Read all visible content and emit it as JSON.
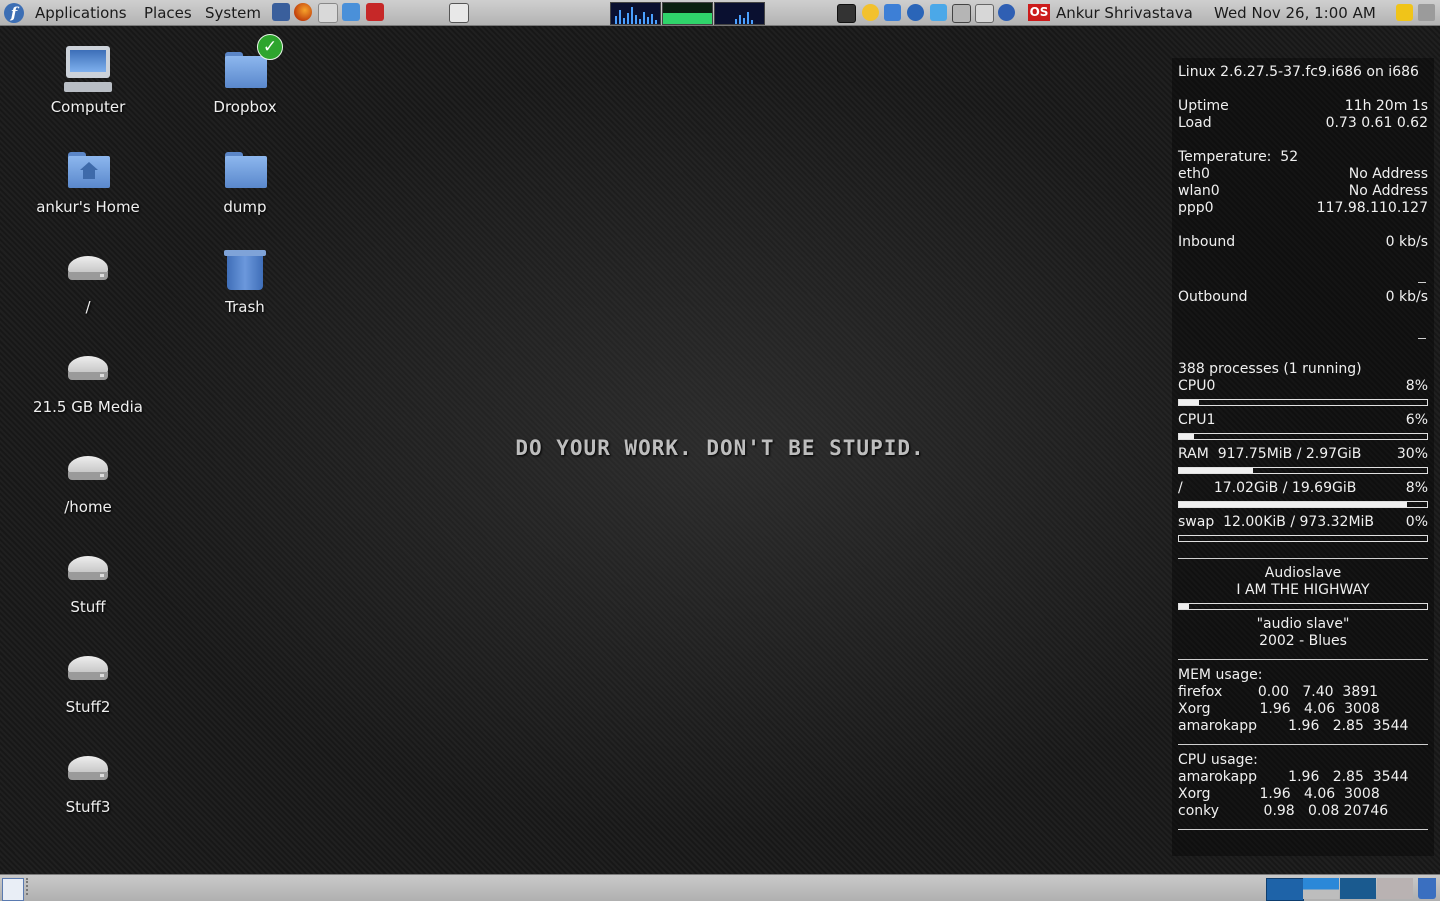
{
  "top_panel": {
    "menus": [
      "Applications",
      "Places",
      "System"
    ],
    "launchers": [
      "save-icon",
      "firefox-icon",
      "mail-icon",
      "document-icon",
      "phone-icon",
      "screenshot-icon"
    ],
    "user": "Ankur Shrivastava",
    "clock": "Wed Nov 26,  1:00 AM",
    "tray_os_label": "OS"
  },
  "desktop": {
    "icons": [
      {
        "label": "Computer",
        "icon": "computer-icon"
      },
      {
        "label": "ankur's Home",
        "icon": "home-folder-icon"
      },
      {
        "label": "/",
        "icon": "drive-icon"
      },
      {
        "label": "21.5 GB Media",
        "icon": "drive-icon"
      },
      {
        "label": "/home",
        "icon": "drive-icon"
      },
      {
        "label": "Stuff",
        "icon": "drive-icon"
      },
      {
        "label": "Stuff2",
        "icon": "drive-icon"
      },
      {
        "label": "Stuff3",
        "icon": "drive-icon"
      },
      {
        "label": "Dropbox",
        "icon": "dropbox-folder-icon"
      },
      {
        "label": "dump",
        "icon": "folder-icon"
      },
      {
        "label": "Trash",
        "icon": "trash-icon"
      }
    ],
    "slogan": "DO YOUR WORK. DON'T BE STUPID."
  },
  "conky": {
    "kernel": "Linux 2.6.27.5-37.fc9.i686 on i686",
    "uptime_label": "Uptime",
    "uptime": "11h 20m 1s",
    "load_label": "Load",
    "load": "0.73 0.61 0.62",
    "temperature": "Temperature:  52",
    "net": [
      {
        "iface": "eth0",
        "addr": "No Address"
      },
      {
        "iface": "wlan0",
        "addr": "No Address"
      },
      {
        "iface": "ppp0",
        "addr": "117.98.110.127"
      }
    ],
    "inbound_label": "Inbound",
    "inbound": "0 kb/s",
    "outbound_label": "Outbound",
    "outbound": "0 kb/s",
    "processes": "388 processes (1 running)",
    "cpu0_label": "CPU0",
    "cpu0": "8%",
    "cpu0_frac": 0.08,
    "cpu1_label": "CPU1",
    "cpu1": "6%",
    "cpu1_frac": 0.06,
    "ram_label": "RAM  917.75MiB / 2.97GiB",
    "ram": "30%",
    "ram_frac": 0.3,
    "root_label": "/       17.02GiB / 19.69GiB",
    "root": "8%",
    "root_frac": 0.92,
    "swap_label": "swap  12.00KiB / 973.32MiB",
    "swap": "0%",
    "swap_frac": 0.0,
    "music": {
      "artist": "Audioslave",
      "title": "I AM THE HIGHWAY",
      "progress_frac": 0.04,
      "album": "\"audio slave\"",
      "year_genre": "2002 - Blues"
    },
    "mem_usage_title": "MEM usage:",
    "mem_usage": [
      "firefox        0.00   7.40  3891",
      "Xorg           1.96   4.06  3008",
      "amarokapp       1.96   2.85  3544"
    ],
    "cpu_usage_title": "CPU usage:",
    "cpu_usage": [
      "amarokapp       1.96   2.85  3544",
      "Xorg           1.96   4.06  3008",
      "conky          0.98   0.08 20746"
    ]
  }
}
